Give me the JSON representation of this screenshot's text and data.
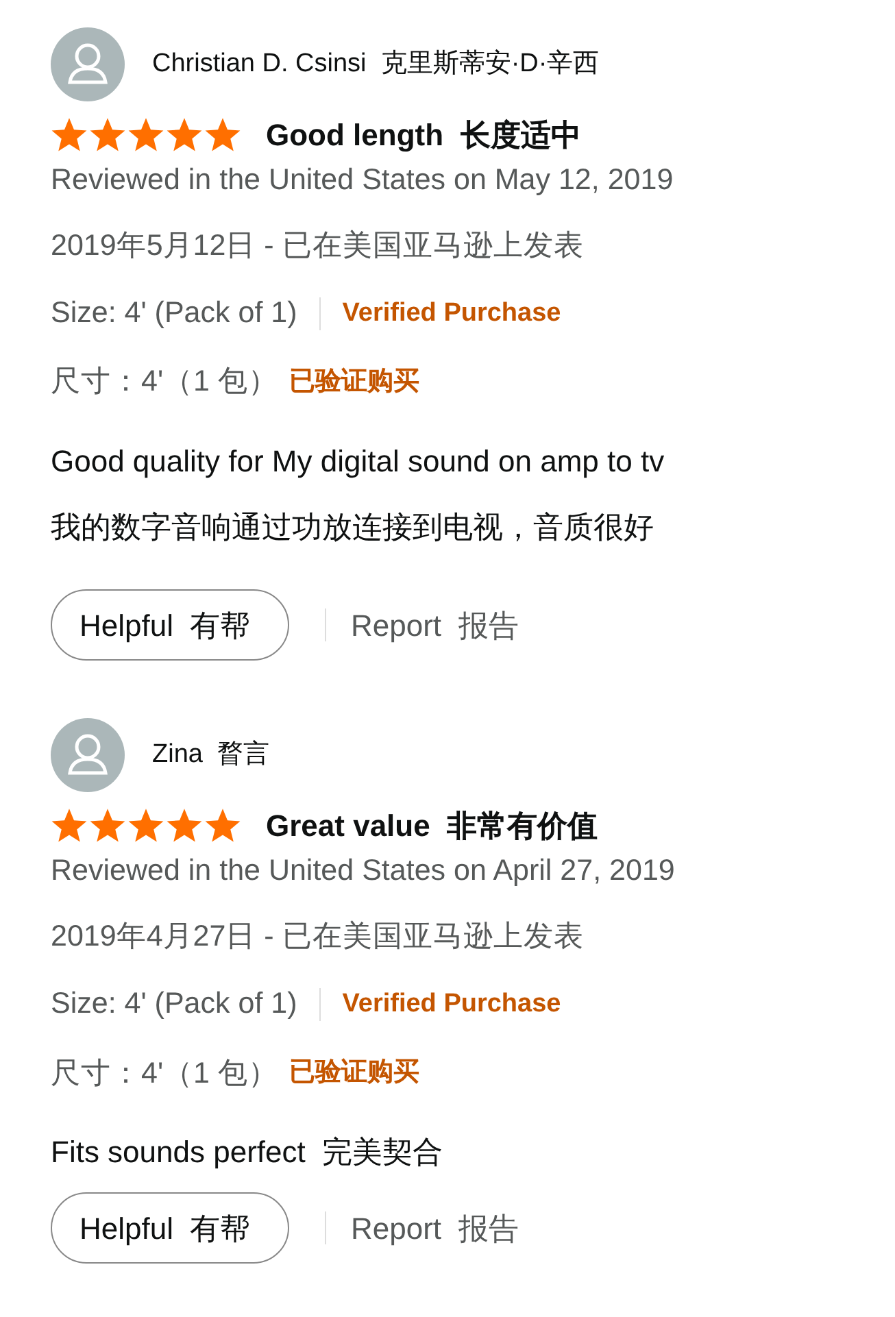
{
  "reviews": [
    {
      "reviewer": "Christian D. Csinsi  克里斯蒂安·D·辛西",
      "stars": 5,
      "title": "Good length  长度适中",
      "reviewed": "Reviewed in the United States on May 12, 2019",
      "reviewed_cn": "2019年5月12日 - 已在美国亚马逊上发表",
      "size": "Size: 4' (Pack of 1)",
      "verified": "Verified Purchase",
      "size_cn": "尺寸：4'（1 包）",
      "verified_cn": "已验证购买",
      "body": [
        "Good quality for My digital sound on amp to tv",
        "我的数字音响通过功放连接到电视，音质很好"
      ],
      "helpful": "Helpful  有帮",
      "report": "Report  报告"
    },
    {
      "reviewer": "Zina  瞀言",
      "stars": 5,
      "title": "Great value  非常有价值",
      "reviewed": "Reviewed in the United States on April 27, 2019",
      "reviewed_cn": "2019年4月27日 - 已在美国亚马逊上发表",
      "size": "Size: 4' (Pack of 1)",
      "verified": "Verified Purchase",
      "size_cn": "尺寸：4'（1 包）",
      "verified_cn": "已验证购买",
      "body": [
        "Fits sounds perfect  完美契合"
      ],
      "helpful": "Helpful  有帮",
      "report": "Report  报告"
    }
  ]
}
